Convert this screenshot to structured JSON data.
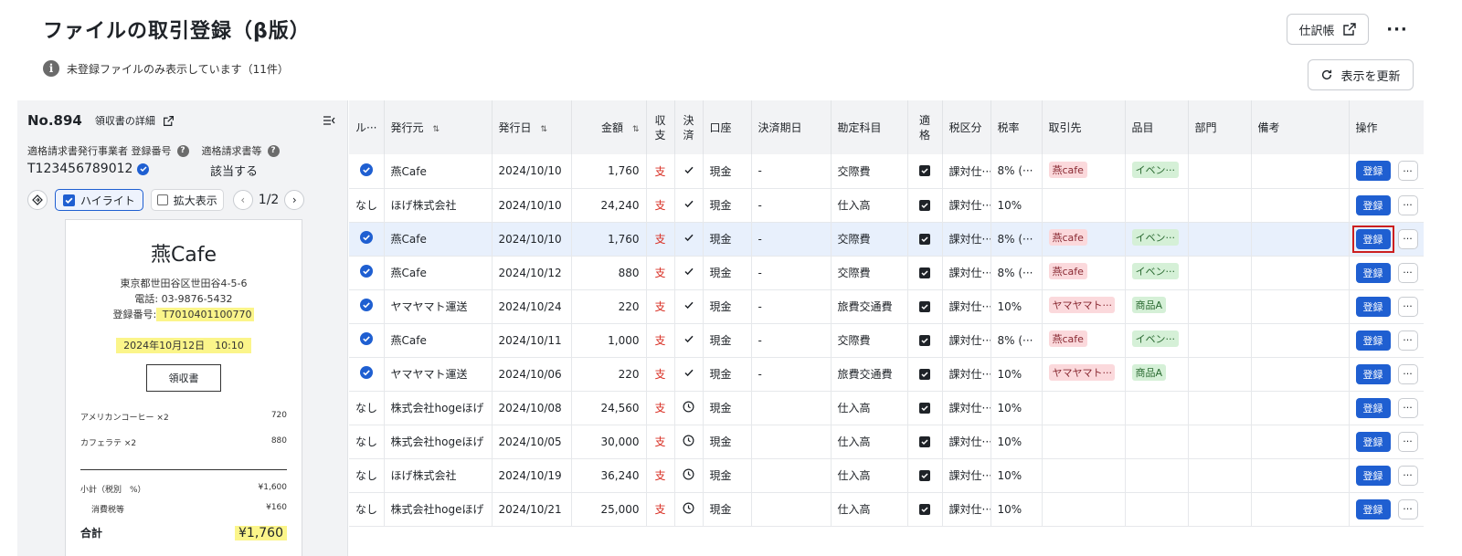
{
  "header": {
    "title": "ファイルの取引登録（β版）",
    "info": "未登録ファイルのみ表示しています（11件）",
    "journal_label": "仕訳帳",
    "more_label": "···",
    "refresh_label": "表示を更新"
  },
  "doc": {
    "number": "No.894",
    "detail_label": "領収書の詳細",
    "invoice_issuer_label": "適格請求書発行事業者 登録番号",
    "invoice_label": "適格請求書等",
    "invoice_number": "T123456789012",
    "invoice_status": "該当する",
    "highlight_label": "ハイライト",
    "zoom_label": "拡大表示",
    "page": "1/2"
  },
  "receipt": {
    "shop": "燕Cafe",
    "address": "東京都世田谷区世田谷4-5-6",
    "tel": "電話: 03-9876-5432",
    "reg_label": "登録番号:",
    "reg_number": " T7010401100770",
    "date": "2024年10月12日　10:10",
    "doc_type": "領収書",
    "items": [
      {
        "name": "アメリカンコーヒー ×2",
        "amount": "720"
      },
      {
        "name": "カフェラテ ×2",
        "amount": "880"
      }
    ],
    "subtotal_label": "小計（税別　%）",
    "subtotal": "¥1,600",
    "tax_label": "消費税等",
    "tax": "¥160",
    "total_label": "合計",
    "total": "¥1,760"
  },
  "table": {
    "headers": {
      "rule": "ル···",
      "issuer": "発行元",
      "date": "発行日",
      "amount": "金額",
      "io_1": "収",
      "io_2": "支",
      "settle_1": "決",
      "settle_2": "済",
      "account": "口座",
      "due": "決済期日",
      "subject": "勘定科目",
      "qual_1": "適",
      "qual_2": "格",
      "tax_class": "税区分",
      "tax_rate": "税率",
      "partner": "取引先",
      "item": "品目",
      "dept": "部門",
      "memo": "備考",
      "ops": "操作"
    },
    "sort_icon": "⇅",
    "register_label": "登録",
    "row_more": "···",
    "rows": [
      {
        "rule": "check",
        "issuer": "燕Cafe",
        "date": "2024/10/10",
        "amount": "1,760",
        "io": "支",
        "settled": "check",
        "account": "現金",
        "due": "-",
        "subject": "交際費",
        "tax_class": "課対仕···",
        "tax_rate": "8% (···",
        "partner": "燕cafe",
        "item": "イベン···"
      },
      {
        "rule": "なし",
        "issuer": "ほげ株式会社",
        "date": "2024/10/10",
        "amount": "24,240",
        "io": "支",
        "settled": "check",
        "account": "現金",
        "due": "-",
        "subject": "仕入高",
        "tax_class": "課対仕···",
        "tax_rate": "10%",
        "partner": "",
        "item": ""
      },
      {
        "rule": "check",
        "issuer": "燕Cafe",
        "date": "2024/10/10",
        "amount": "1,760",
        "io": "支",
        "settled": "check",
        "account": "現金",
        "due": "-",
        "subject": "交際費",
        "tax_class": "課対仕···",
        "tax_rate": "8% (···",
        "partner": "燕cafe",
        "item": "イベン···"
      },
      {
        "rule": "check",
        "issuer": "燕Cafe",
        "date": "2024/10/12",
        "amount": "880",
        "io": "支",
        "settled": "check",
        "account": "現金",
        "due": "-",
        "subject": "交際費",
        "tax_class": "課対仕···",
        "tax_rate": "8% (···",
        "partner": "燕cafe",
        "item": "イベン···"
      },
      {
        "rule": "check",
        "issuer": "ヤマヤマト運送",
        "date": "2024/10/24",
        "amount": "220",
        "io": "支",
        "settled": "check",
        "account": "現金",
        "due": "-",
        "subject": "旅費交通費",
        "tax_class": "課対仕···",
        "tax_rate": "10%",
        "partner": "ヤマヤマト···",
        "item": "商品A"
      },
      {
        "rule": "check",
        "issuer": "燕Cafe",
        "date": "2024/10/11",
        "amount": "1,000",
        "io": "支",
        "settled": "check",
        "account": "現金",
        "due": "-",
        "subject": "交際費",
        "tax_class": "課対仕···",
        "tax_rate": "8% (···",
        "partner": "燕cafe",
        "item": "イベン···"
      },
      {
        "rule": "check",
        "issuer": "ヤマヤマト運送",
        "date": "2024/10/06",
        "amount": "220",
        "io": "支",
        "settled": "check",
        "account": "現金",
        "due": "-",
        "subject": "旅費交通費",
        "tax_class": "課対仕···",
        "tax_rate": "10%",
        "partner": "ヤマヤマト···",
        "item": "商品A"
      },
      {
        "rule": "なし",
        "issuer": "株式会社hogeほげ",
        "date": "2024/10/08",
        "amount": "24,560",
        "io": "支",
        "settled": "clock",
        "account": "現金",
        "due": "",
        "subject": "仕入高",
        "tax_class": "課対仕···",
        "tax_rate": "10%",
        "partner": "",
        "item": ""
      },
      {
        "rule": "なし",
        "issuer": "株式会社hogeほげ",
        "date": "2024/10/05",
        "amount": "30,000",
        "io": "支",
        "settled": "clock",
        "account": "現金",
        "due": "",
        "subject": "仕入高",
        "tax_class": "課対仕···",
        "tax_rate": "10%",
        "partner": "",
        "item": ""
      },
      {
        "rule": "なし",
        "issuer": "ほげ株式会社",
        "date": "2024/10/19",
        "amount": "36,240",
        "io": "支",
        "settled": "clock",
        "account": "現金",
        "due": "",
        "subject": "仕入高",
        "tax_class": "課対仕···",
        "tax_rate": "10%",
        "partner": "",
        "item": ""
      },
      {
        "rule": "なし",
        "issuer": "株式会社hogeほげ",
        "date": "2024/10/21",
        "amount": "25,000",
        "io": "支",
        "settled": "clock",
        "account": "現金",
        "due": "",
        "subject": "仕入高",
        "tax_class": "課対仕···",
        "tax_rate": "10%",
        "partner": "",
        "item": ""
      }
    ]
  },
  "colors": {
    "accent": "#1f5fd1",
    "expense": "#d93025",
    "highlight_marker": "#fbf58a",
    "focus_outline": "#cc1f1f"
  }
}
